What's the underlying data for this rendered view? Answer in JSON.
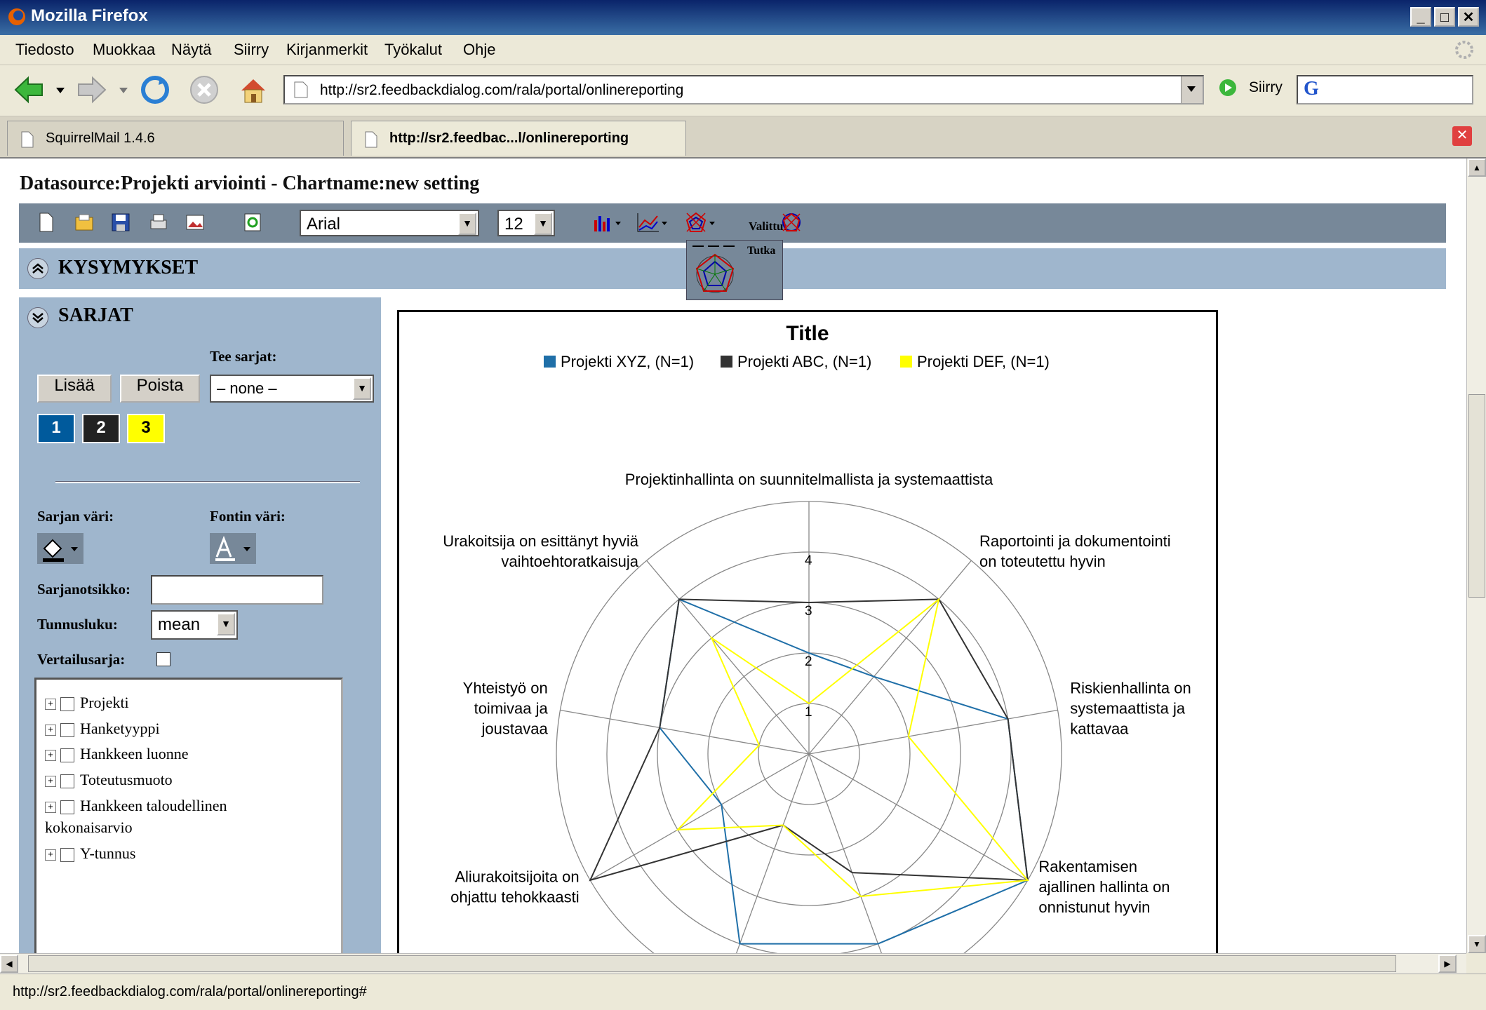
{
  "window": {
    "title": "Mozilla Firefox"
  },
  "menu": [
    "Tiedosto",
    "Muokkaa",
    "Näytä",
    "Siirry",
    "Kirjanmerkit",
    "Työkalut",
    "Ohje"
  ],
  "nav": {
    "url": "http://sr2.feedbackdialog.com/rala/portal/onlinereporting",
    "go_label": "Siirry",
    "search_logo": "G"
  },
  "tabs": [
    {
      "label": "SquirrelMail 1.4.6"
    },
    {
      "label": "http://sr2.feedbac...l/onlinereporting"
    }
  ],
  "page": {
    "title": "Datasource:Projekti arviointi - Chartname:new setting",
    "font_select": "Arial",
    "size_select": "12",
    "valittu_label": "Valittu:",
    "popup_label": "Tutka",
    "kysymykset": "KYSYMYKSET"
  },
  "sidebar": {
    "title": "SARJAT",
    "tee_sarjat_label": "Tee sarjat:",
    "add_button": "Lisää",
    "remove_button": "Poista",
    "tee_sarjat_value": "– none –",
    "series_swatches": [
      {
        "label": "1",
        "color": "#005a9c"
      },
      {
        "label": "2",
        "color": "#222222"
      },
      {
        "label": "3",
        "color": "#ffff00"
      }
    ],
    "sarjan_vari_label": "Sarjan väri:",
    "fontin_vari_label": "Fontin väri:",
    "sarjanotsikko_label": "Sarjanotsikko:",
    "sarjanotsikko_value": "",
    "tunnusluku_label": "Tunnusluku:",
    "tunnusluku_value": "mean",
    "vertailusarja_label": "Vertailusarja:",
    "tree": [
      "Projekti",
      "Hanketyyppi",
      "Hankkeen luonne",
      "Toteutusmuoto",
      "Hankkeen taloudellinen",
      "kokonaisarvio",
      "Y-tunnus"
    ]
  },
  "chart_data": {
    "type": "radar",
    "title": "Title",
    "rmax": 5,
    "ticks": [
      1,
      2,
      3,
      4
    ],
    "axes": [
      [
        "Projektinhallinta on suunnitelmallista ja systemaattista"
      ],
      [
        "Raportointi ja dokumentointi",
        "on toteutettu hyvin"
      ],
      [
        "Riskienhallinta on",
        "systemaattista ja",
        "kattavaa"
      ],
      [
        "Rakentamisen",
        "ajallinen hallinta on",
        "onnistunut hyvin"
      ],
      [],
      [],
      [
        "Aliurakoitsijoita on",
        "ohjattu tehokkaasti"
      ],
      [
        "Yhteistyö on",
        "toimivaa ja",
        "joustavaa"
      ],
      [
        "Urakoitsija on esittänyt hyviä",
        "vaihtoehtoratkaisuja"
      ]
    ],
    "series": [
      {
        "name": "Projekti XYZ, (N=1)",
        "color": "#1f6fa8",
        "values": [
          2,
          2,
          4,
          5,
          4,
          4,
          2,
          3,
          4
        ]
      },
      {
        "name": "Projekti ABC, (N=1)",
        "color": "#333333",
        "values": [
          3,
          4,
          4,
          5,
          2.5,
          1.5,
          5,
          3,
          4
        ]
      },
      {
        "name": "Projekti DEF, (N=1)",
        "color": "#ffff00",
        "values": [
          1,
          4,
          2,
          5,
          3,
          1.5,
          3,
          1,
          3
        ]
      }
    ]
  },
  "status": {
    "text": "http://sr2.feedbackdialog.com/rala/portal/onlinereporting#"
  }
}
